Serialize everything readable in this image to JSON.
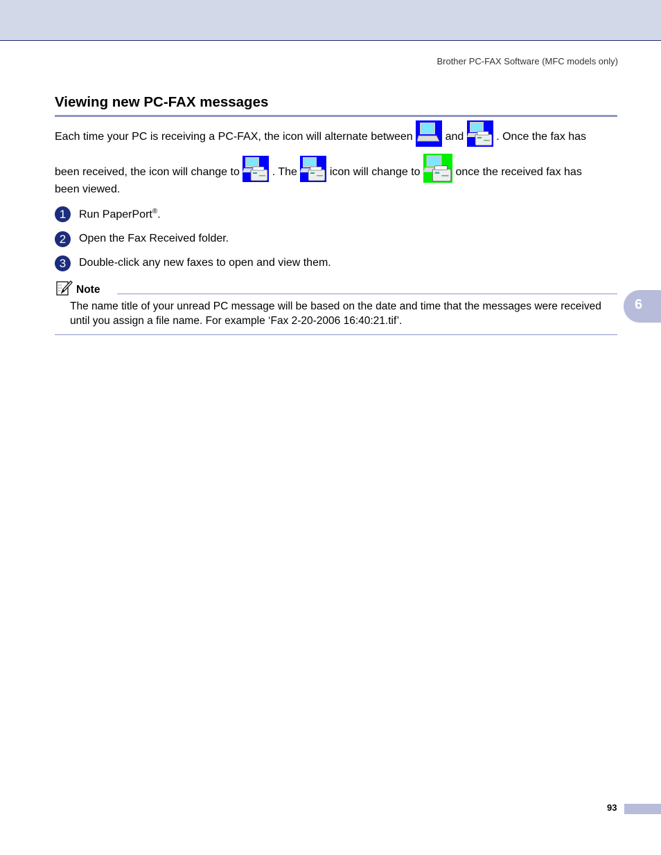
{
  "header": {
    "running_head": "Brother PC-FAX Software (MFC models only)"
  },
  "section": {
    "title": "Viewing new PC-FAX messages"
  },
  "paragraph": {
    "line1_a": "Each time your PC is receiving a PC-FAX, the icon will alternate between",
    "line1_b": "and",
    "line1_c": ". Once the fax has",
    "line2_a": "been received, the icon will change to",
    "line2_b": ". The",
    "line2_c": "icon will change to",
    "line2_d": "once the received fax has",
    "line3": "been viewed.",
    "icons": [
      {
        "name": "pc-receiving-icon",
        "background": "#0000ff"
      },
      {
        "name": "pc-fax-receiving-icon",
        "background": "#0000ff"
      },
      {
        "name": "fax-received-icon",
        "background": "#0000ff"
      },
      {
        "name": "fax-received-icon",
        "background": "#0000ff"
      },
      {
        "name": "fax-viewed-icon",
        "background": "#00ee00"
      }
    ]
  },
  "steps": [
    {
      "number": "1",
      "text": "Run PaperPort",
      "superscript": "®",
      "suffix": "."
    },
    {
      "number": "2",
      "text": "Open the Fax Received folder."
    },
    {
      "number": "3",
      "text": "Double-click any new faxes to open and view them."
    }
  ],
  "note": {
    "label": "Note",
    "text": "The name title of your unread PC message will be based on the date and time that the messages were received until you assign a file name. For example ‘Fax 2-20-2006 16:40:21.tif’."
  },
  "chapter_tab": "6",
  "footer": {
    "page_number": "93"
  },
  "colors": {
    "accent": "#8e97c4",
    "header_band": "#d3d8e8",
    "step_circle": "#1c2d7c",
    "tab": "#b7bcdb"
  }
}
